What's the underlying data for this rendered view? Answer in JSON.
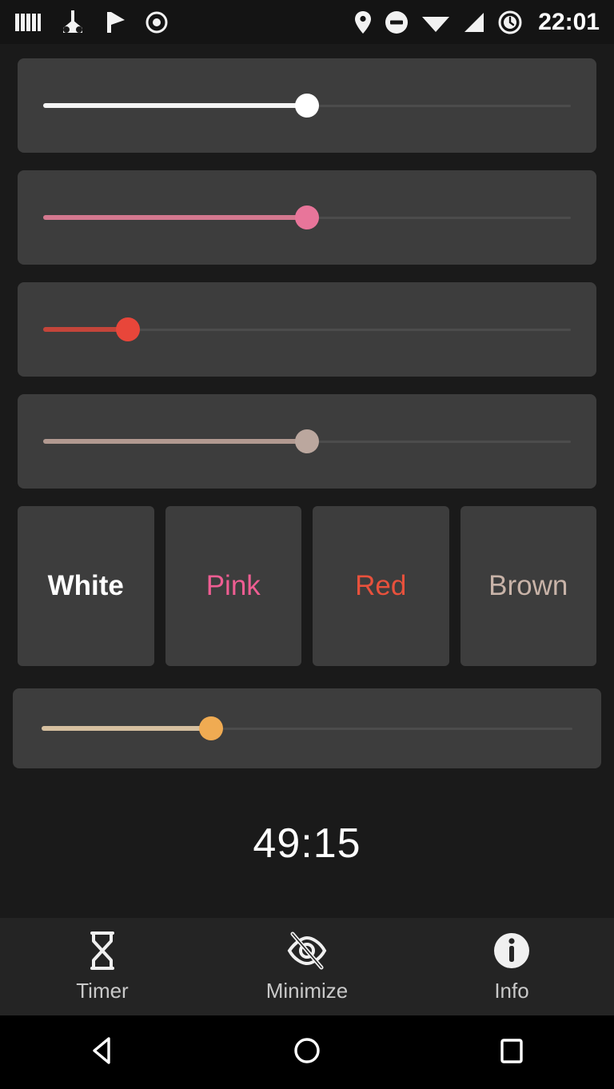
{
  "status_bar": {
    "time": "22:01",
    "left_icons": [
      {
        "name": "network-operator-icon",
        "label": "NW"
      },
      {
        "name": "screencast-icon",
        "label": "cast"
      },
      {
        "name": "flag-icon",
        "label": "flag"
      },
      {
        "name": "target-icon",
        "label": "target"
      }
    ],
    "right_icons": [
      {
        "name": "location-pin-icon",
        "label": "location"
      },
      {
        "name": "do-not-disturb-icon",
        "label": "dnd"
      },
      {
        "name": "wifi-icon",
        "label": "wifi"
      },
      {
        "name": "signal-bars-icon",
        "label": "signal"
      },
      {
        "name": "alarm-clock-icon",
        "label": "alarm"
      }
    ]
  },
  "noise_sliders": [
    {
      "name": "white-noise",
      "label": "White",
      "value": 50,
      "track_color": "#f4f4f4",
      "thumb_color": "#ffffff"
    },
    {
      "name": "pink-noise",
      "label": "Pink",
      "value": 50,
      "track_color": "#d4788f",
      "thumb_color": "#e8759a"
    },
    {
      "name": "red-noise",
      "label": "Red",
      "value": 16,
      "track_color": "#c4453a",
      "thumb_color": "#e8463a"
    },
    {
      "name": "brown-noise",
      "label": "Brown",
      "value": 50,
      "track_color": "#b29a91",
      "thumb_color": "#bba79e"
    }
  ],
  "color_buttons": [
    {
      "name": "white",
      "label": "White",
      "color": "#ffffff",
      "selected": true
    },
    {
      "name": "pink",
      "label": "Pink",
      "color": "#ef5d92",
      "selected": false
    },
    {
      "name": "red",
      "label": "Red",
      "color": "#e8513c",
      "selected": false
    },
    {
      "name": "brown",
      "label": "Brown",
      "color": "#c8b3a8",
      "selected": false
    }
  ],
  "volume_slider": {
    "name": "master-volume",
    "value": 32,
    "track_color": "#d6c0a0",
    "thumb_color": "#f0ab52"
  },
  "timer": {
    "display": "49:15"
  },
  "bottom_nav": [
    {
      "name": "timer",
      "label": "Timer",
      "icon": "hourglass-icon"
    },
    {
      "name": "minimize",
      "label": "Minimize",
      "icon": "eye-off-icon"
    },
    {
      "name": "info",
      "label": "Info",
      "icon": "info-circle-icon"
    }
  ],
  "system_nav": [
    {
      "name": "back",
      "icon": "back-triangle-icon"
    },
    {
      "name": "home",
      "icon": "home-circle-icon"
    },
    {
      "name": "recents",
      "icon": "recents-square-icon"
    }
  ]
}
